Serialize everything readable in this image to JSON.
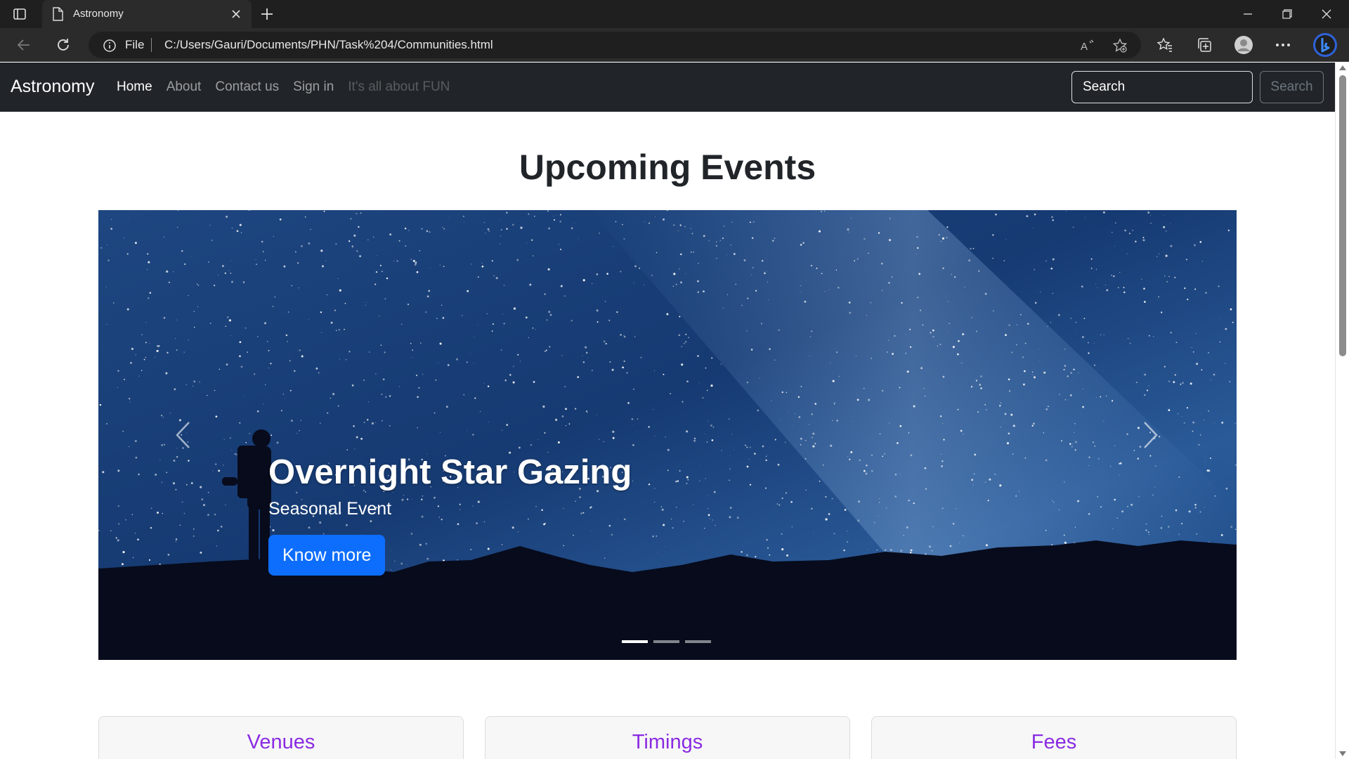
{
  "browser": {
    "tab_title": "Astronomy",
    "address_scheme": "File",
    "url": "C:/Users/Gauri/Documents/PHN/Task%204/Communities.html"
  },
  "navbar": {
    "brand": "Astronomy",
    "links": [
      {
        "label": "Home",
        "state": "active"
      },
      {
        "label": "About",
        "state": "normal"
      },
      {
        "label": "Contact us",
        "state": "normal"
      },
      {
        "label": "Sign in",
        "state": "normal"
      },
      {
        "label": "It's all about FUN",
        "state": "disabled"
      }
    ],
    "search_placeholder": "Search",
    "search_button": "Search"
  },
  "page": {
    "heading": "Upcoming Events"
  },
  "carousel": {
    "slide_title": "Overnight Star Gazing",
    "slide_subtitle": "Seasonal Event",
    "button_label": "Know more",
    "indicator_count": 3,
    "active_indicator": 0
  },
  "cards": [
    {
      "title": "Venues"
    },
    {
      "title": "Timings"
    },
    {
      "title": "Fees"
    }
  ],
  "colors": {
    "navbar_bg": "#212529",
    "primary_button": "#0d6efd",
    "card_title": "#8a2be2",
    "browser_chrome": "#1f1f1f"
  }
}
